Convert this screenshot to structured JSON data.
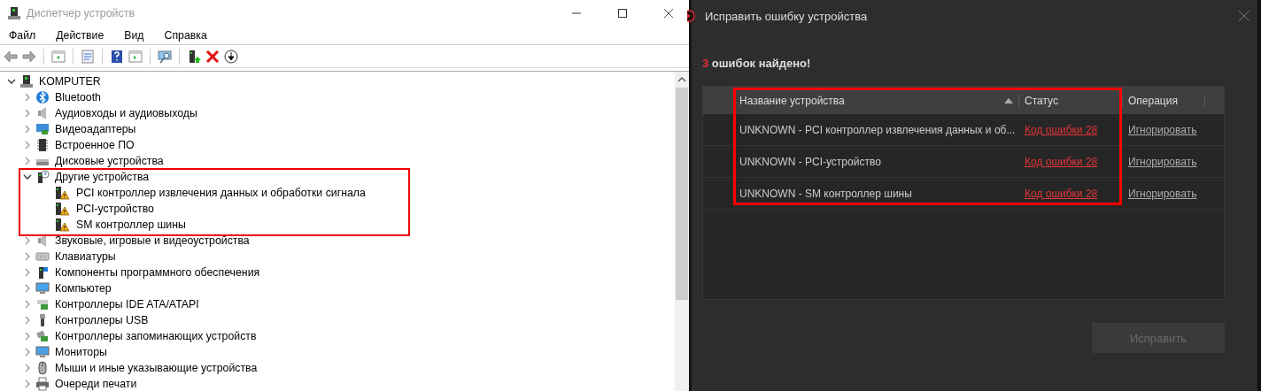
{
  "device_manager": {
    "window": {
      "title": "Диспетчер устройств"
    },
    "menu": [
      "Файл",
      "Действие",
      "Вид",
      "Справка"
    ],
    "tree": {
      "label": "KOMPUTER",
      "expanded": true,
      "children": [
        {
          "label": "Bluetooth",
          "expanded": false
        },
        {
          "label": "Аудиовходы и аудиовыходы",
          "expanded": false
        },
        {
          "label": "Видеоадаптеры",
          "expanded": false
        },
        {
          "label": "Встроенное ПО",
          "expanded": false
        },
        {
          "label": "Дисковые устройства",
          "expanded": false
        },
        {
          "label": "Другие устройства",
          "expanded": true,
          "highlighted": true,
          "children": [
            {
              "label": "PCI контроллер извлечения данных и обработки сигнала",
              "warning": true
            },
            {
              "label": "PCI-устройство",
              "warning": true
            },
            {
              "label": "SM контроллер шины",
              "warning": true
            }
          ]
        },
        {
          "label": "Звуковые, игровые и видеоустройства",
          "expanded": false
        },
        {
          "label": "Клавиатуры",
          "expanded": false
        },
        {
          "label": "Компоненты программного обеспечения",
          "expanded": false
        },
        {
          "label": "Компьютер",
          "expanded": false
        },
        {
          "label": "Контроллеры IDE ATA/ATAPI",
          "expanded": false
        },
        {
          "label": "Контроллеры USB",
          "expanded": false
        },
        {
          "label": "Контроллеры запоминающих устройств",
          "expanded": false
        },
        {
          "label": "Мониторы",
          "expanded": false
        },
        {
          "label": "Мыши и иные указывающие устройства",
          "expanded": false
        },
        {
          "label": "Очереди печати",
          "expanded": false
        }
      ]
    }
  },
  "fix_dialog": {
    "title": "Исправить ошибку устройства",
    "summary": {
      "count": "3",
      "text": "ошибок найдено!"
    },
    "table": {
      "highlighted": true,
      "columns": [
        {
          "label": "Название устройства",
          "sorted": true
        },
        {
          "label": "Статус",
          "sorted": false
        },
        {
          "label": "Операция",
          "sorted": false
        }
      ],
      "rows": [
        {
          "device": "UNKNOWN - PCI контроллер извлечения данных и об...",
          "status": "Код ошибки 28",
          "action": "Игнорировать"
        },
        {
          "device": "UNKNOWN - PCI-устройство",
          "status": "Код ошибки 28",
          "action": "Игнорировать"
        },
        {
          "device": "UNKNOWN - SM контроллер шины",
          "status": "Код ошибки 28",
          "action": "Игнорировать"
        }
      ]
    },
    "fix_button": {
      "label": "Исправить",
      "disabled": true
    }
  }
}
